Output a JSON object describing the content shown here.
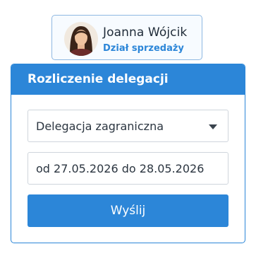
{
  "user": {
    "name": "Joanna  Wójcik",
    "department": "Dział sprzedaży"
  },
  "form": {
    "title": "Rozliczenie delegacji",
    "delegation_type": {
      "selected": "Delegacja zagraniczna"
    },
    "date_range": "od 27.05.2026 do 28.05.2026",
    "submit_label": "Wyślij"
  },
  "icons": {
    "avatar": "user-avatar",
    "dropdown": "caret-down-icon"
  },
  "colors": {
    "accent": "#2c86d8",
    "card_border": "#8fb8e2",
    "card_background": "#f7fbff",
    "field_border": "#cfd5dc",
    "text": "#2b3540"
  }
}
